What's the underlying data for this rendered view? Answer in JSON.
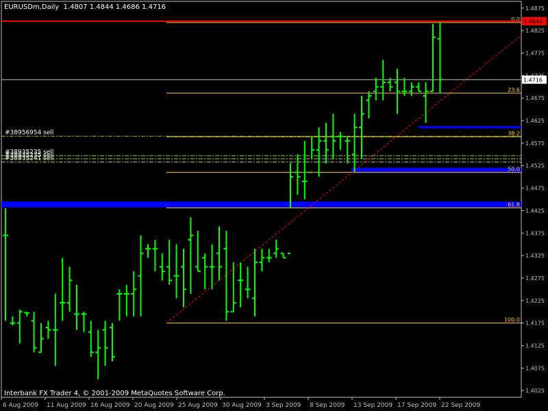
{
  "header": {
    "symbol_timeframe": "EURUSDm,Daily",
    "ohlc": "1.4807 1.4844 1.4686 1.4716"
  },
  "footer": {
    "copyright": "Interbank FX Trader 4, © 2001-2009 MetaQuotes Software Corp."
  },
  "price_axis": {
    "ticks": [
      "1.4875",
      "1.4825",
      "1.4775",
      "1.4725",
      "1.4675",
      "1.4625",
      "1.4575",
      "1.4525",
      "1.4475",
      "1.4425",
      "1.4375",
      "1.4325",
      "1.4275",
      "1.4225",
      "1.4175",
      "1.4125",
      "1.4075",
      "1.4025"
    ],
    "current_bid": "1.4844",
    "current_price": "1.4716"
  },
  "time_axis": {
    "labels": [
      "6 Aug 2009",
      "11 Aug 2009",
      "16 Aug 2009",
      "20 Aug 2009",
      "25 Aug 2009",
      "30 Aug 2009",
      "3 Sep 2009",
      "8 Sep 2009",
      "13 Sep 2009",
      "17 Sep 2009",
      "22 Sep 2009"
    ]
  },
  "fibonacci": {
    "levels": [
      {
        "label": "0.0",
        "price": 1.4843
      },
      {
        "label": "23.6",
        "price": 1.4686
      },
      {
        "label": "38.2",
        "price": 1.4589
      },
      {
        "label": "50.0",
        "price": 1.451
      },
      {
        "label": "61.8",
        "price": 1.4431
      },
      {
        "label": "100.0",
        "price": 1.4175
      }
    ]
  },
  "orders": [
    {
      "label": "#38956954 sell",
      "price": 1.459
    },
    {
      "label": "#38935235 sell",
      "price": 1.4547
    },
    {
      "label": "#38935235 sell",
      "price": 1.454
    },
    {
      "label": "#38935241 sell",
      "price": 1.4533
    }
  ],
  "colors": {
    "background": "#000000",
    "candle": "#00ff00",
    "bid_line": "#ff0000",
    "fibo": "#ffcc33",
    "zone": "#0000ff",
    "axis": "#c0c0c0",
    "trendline": "#ff0000"
  },
  "chart_data": {
    "type": "ohlc",
    "symbol": "EURUSDm",
    "timeframe": "Daily",
    "price_range": [
      1.401,
      1.489
    ],
    "bars": [
      {
        "o": 1.437,
        "h": 1.443,
        "l": 1.418,
        "c": 1.437
      },
      {
        "o": 1.4175,
        "h": 1.419,
        "l": 1.417,
        "c": 1.4175
      },
      {
        "o": 1.4175,
        "h": 1.4205,
        "l": 1.413,
        "c": 1.42
      },
      {
        "o": 1.4198,
        "h": 1.42,
        "l": 1.419,
        "c": 1.4197
      },
      {
        "o": 1.418,
        "h": 1.42,
        "l": 1.411,
        "c": 1.412
      },
      {
        "o": 1.411,
        "h": 1.4175,
        "l": 1.411,
        "c": 1.414
      },
      {
        "o": 1.4165,
        "h": 1.418,
        "l": 1.414,
        "c": 1.416
      },
      {
        "o": 1.416,
        "h": 1.424,
        "l": 1.408,
        "c": 1.416
      },
      {
        "o": 1.422,
        "h": 1.432,
        "l": 1.418,
        "c": 1.422
      },
      {
        "o": 1.422,
        "h": 1.43,
        "l": 1.42,
        "c": 1.427
      },
      {
        "o": 1.4195,
        "h": 1.426,
        "l": 1.416,
        "c": 1.4195
      },
      {
        "o": 1.4195,
        "h": 1.42,
        "l": 1.4155,
        "c": 1.4195
      },
      {
        "o": 1.4155,
        "h": 1.418,
        "l": 1.41,
        "c": 1.411
      },
      {
        "o": 1.411,
        "h": 1.416,
        "l": 1.405,
        "c": 1.412
      },
      {
        "o": 1.416,
        "h": 1.418,
        "l": 1.408,
        "c": 1.412
      },
      {
        "o": 1.4165,
        "h": 1.4175,
        "l": 1.409,
        "c": 1.41
      },
      {
        "o": 1.424,
        "h": 1.425,
        "l": 1.418,
        "c": 1.424
      },
      {
        "o": 1.424,
        "h": 1.426,
        "l": 1.419,
        "c": 1.424
      },
      {
        "o": 1.424,
        "h": 1.429,
        "l": 1.419,
        "c": 1.425
      },
      {
        "o": 1.428,
        "h": 1.437,
        "l": 1.419,
        "c": 1.433
      },
      {
        "o": 1.434,
        "h": 1.435,
        "l": 1.432,
        "c": 1.434
      },
      {
        "o": 1.434,
        "h": 1.436,
        "l": 1.429,
        "c": 1.434
      },
      {
        "o": 1.43,
        "h": 1.433,
        "l": 1.427,
        "c": 1.429
      },
      {
        "o": 1.43,
        "h": 1.436,
        "l": 1.426,
        "c": 1.427
      },
      {
        "o": 1.428,
        "h": 1.435,
        "l": 1.423,
        "c": 1.428
      },
      {
        "o": 1.43,
        "h": 1.434,
        "l": 1.421,
        "c": 1.425
      },
      {
        "o": 1.436,
        "h": 1.441,
        "l": 1.424,
        "c": 1.437
      },
      {
        "o": 1.43,
        "h": 1.438,
        "l": 1.429,
        "c": 1.429
      },
      {
        "o": 1.432,
        "h": 1.433,
        "l": 1.425,
        "c": 1.43
      },
      {
        "o": 1.43,
        "h": 1.435,
        "l": 1.425,
        "c": 1.43
      },
      {
        "o": 1.433,
        "h": 1.439,
        "l": 1.427,
        "c": 1.43
      },
      {
        "o": 1.434,
        "h": 1.438,
        "l": 1.418,
        "c": 1.42
      },
      {
        "o": 1.42,
        "h": 1.431,
        "l": 1.42,
        "c": 1.422
      },
      {
        "o": 1.427,
        "h": 1.431,
        "l": 1.421,
        "c": 1.427
      },
      {
        "o": 1.425,
        "h": 1.43,
        "l": 1.423,
        "c": 1.425
      },
      {
        "o": 1.423,
        "h": 1.434,
        "l": 1.419,
        "c": 1.431
      },
      {
        "o": 1.431,
        "h": 1.434,
        "l": 1.429,
        "c": 1.432
      },
      {
        "o": 1.432,
        "h": 1.434,
        "l": 1.431,
        "c": 1.432
      },
      {
        "o": 1.433,
        "h": 1.436,
        "l": 1.432,
        "c": 1.434
      },
      {
        "o": 1.433,
        "h": 1.433,
        "l": 1.432,
        "c": 1.432
      },
      {
        "o": 1.433,
        "h": 1.453,
        "l": 1.443,
        "c": 1.45
      },
      {
        "o": 1.451,
        "h": 1.455,
        "l": 1.446,
        "c": 1.45
      },
      {
        "o": 1.449,
        "h": 1.458,
        "l": 1.445,
        "c": 1.449
      },
      {
        "o": 1.451,
        "h": 1.459,
        "l": 1.454,
        "c": 1.456
      },
      {
        "o": 1.456,
        "h": 1.461,
        "l": 1.45,
        "c": 1.458
      },
      {
        "o": 1.458,
        "h": 1.462,
        "l": 1.453,
        "c": 1.456
      },
      {
        "o": 1.459,
        "h": 1.464,
        "l": 1.454,
        "c": 1.458
      },
      {
        "o": 1.459,
        "h": 1.46,
        "l": 1.456,
        "c": 1.459
      },
      {
        "o": 1.458,
        "h": 1.459,
        "l": 1.453,
        "c": 1.458
      },
      {
        "o": 1.455,
        "h": 1.464,
        "l": 1.451,
        "c": 1.461
      },
      {
        "o": 1.461,
        "h": 1.468,
        "l": 1.454,
        "c": 1.464
      },
      {
        "o": 1.467,
        "h": 1.469,
        "l": 1.463,
        "c": 1.468
      },
      {
        "o": 1.469,
        "h": 1.472,
        "l": 1.467,
        "c": 1.47
      },
      {
        "o": 1.47,
        "h": 1.476,
        "l": 1.467,
        "c": 1.471
      },
      {
        "o": 1.471,
        "h": 1.472,
        "l": 1.469,
        "c": 1.47
      },
      {
        "o": 1.471,
        "h": 1.474,
        "l": 1.464,
        "c": 1.469
      },
      {
        "o": 1.469,
        "h": 1.472,
        "l": 1.468,
        "c": 1.469
      },
      {
        "o": 1.469,
        "h": 1.471,
        "l": 1.468,
        "c": 1.47
      },
      {
        "o": 1.47,
        "h": 1.471,
        "l": 1.469,
        "c": 1.469
      },
      {
        "o": 1.468,
        "h": 1.471,
        "l": 1.462,
        "c": 1.469
      },
      {
        "o": 1.469,
        "h": 1.484,
        "l": 1.469,
        "c": 1.481
      },
      {
        "o": 1.4807,
        "h": 1.4844,
        "l": 1.4686,
        "c": 1.4716
      }
    ]
  }
}
